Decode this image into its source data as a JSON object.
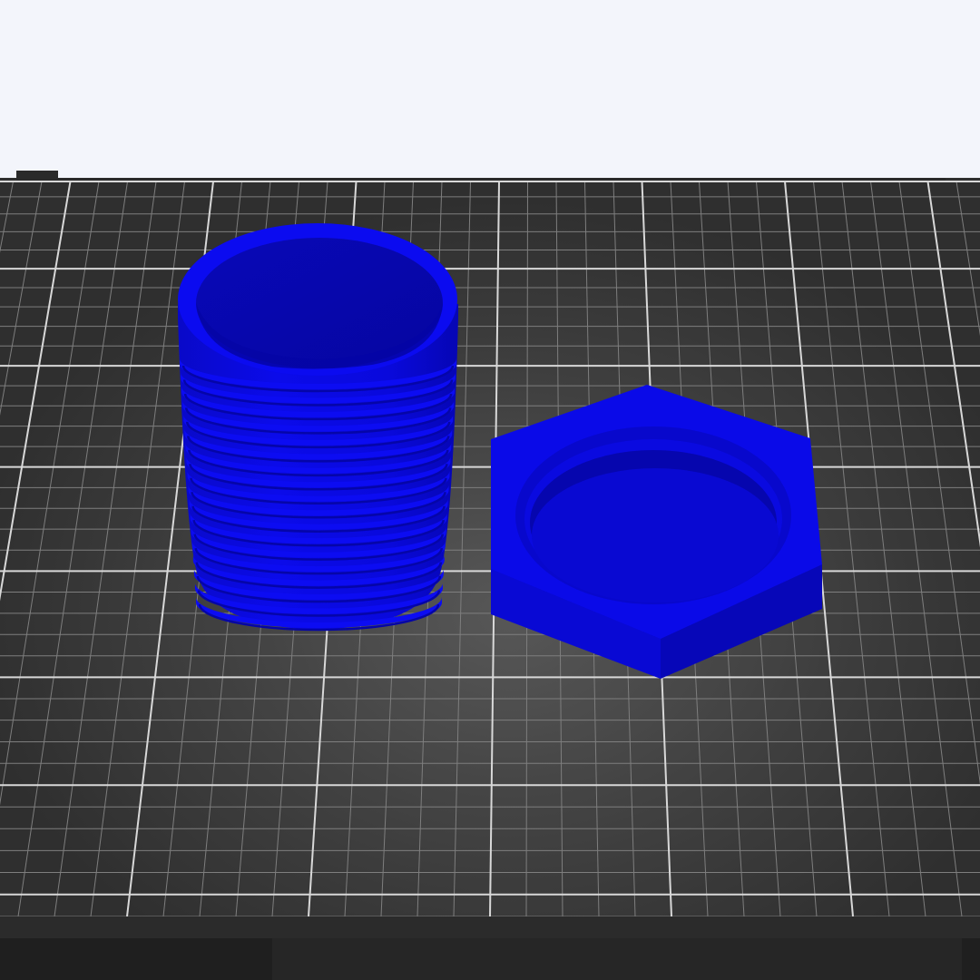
{
  "viewport": {
    "background_color": "#f3f5fb",
    "bed_color": "#3c3c3c",
    "bed_edge_color": "#232323",
    "grid_minor_color": "#7e7e7e",
    "grid_major_color": "#d8d8d8",
    "highlight_color": "#5a5a5a"
  },
  "objects": [
    {
      "name": "threaded-container",
      "shape": "cylinder",
      "feature": "external-thread",
      "color": "#0a0ae6"
    },
    {
      "name": "hexagonal-lid",
      "shape": "hexagon",
      "feature": "internal-thread-recess",
      "color": "#0a0ae6"
    }
  ]
}
